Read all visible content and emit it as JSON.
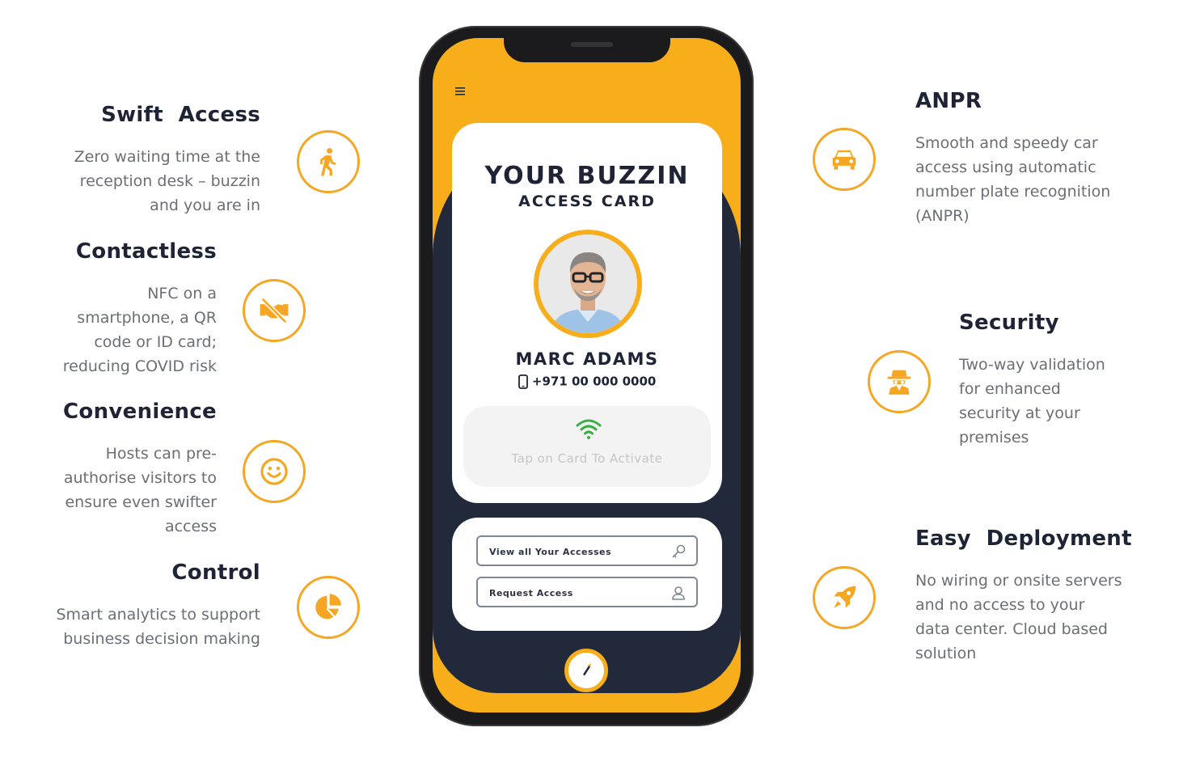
{
  "features_left": [
    {
      "title": "Swift  Access",
      "text_lines": [
        "Zero waiting time at the",
        "reception desk – buzzin",
        "and you are in"
      ],
      "icon": "walking-person-icon"
    },
    {
      "title": "Contactless",
      "text_lines": [
        "NFC on a",
        "smartphone, a QR",
        "code or ID card;",
        "reducing COVID risk"
      ],
      "icon": "no-handshake-icon"
    },
    {
      "title": "Convenience",
      "text_lines": [
        "Hosts can pre-",
        "authorise visitors to",
        "ensure even swifter",
        "access"
      ],
      "icon": "smiley-icon"
    },
    {
      "title": "Control",
      "text_lines": [
        "Smart analytics to support",
        "business decision making"
      ],
      "icon": "pie-chart-icon"
    }
  ],
  "features_right": [
    {
      "title": "ANPR",
      "text_lines": [
        "Smooth and speedy car",
        "access using automatic",
        "number plate recognition",
        "(ANPR)"
      ],
      "icon": "car-icon"
    },
    {
      "title": "Security",
      "text_lines": [
        "Two-way validation",
        "for enhanced",
        "security at your",
        "premises"
      ],
      "icon": "spy-icon"
    },
    {
      "title": "Easy  Deployment",
      "text_lines": [
        "No wiring or onsite servers",
        "and no access to your",
        "data center. Cloud based",
        "solution"
      ],
      "icon": "rocket-icon"
    }
  ],
  "phone": {
    "card_title": "YOUR BUZZIN",
    "card_subtitle": "ACCESS CARD",
    "name": "MARC ADAMS",
    "phone_number": "+971 00 000 0000",
    "tap_text": "Tap on Card To Activate",
    "view_accesses_label": "View all Your Accesses",
    "request_access_label": "Request Access"
  },
  "colors": {
    "accent": "#f5a623",
    "navy": "#22293a",
    "wifi": "#3cb043"
  }
}
